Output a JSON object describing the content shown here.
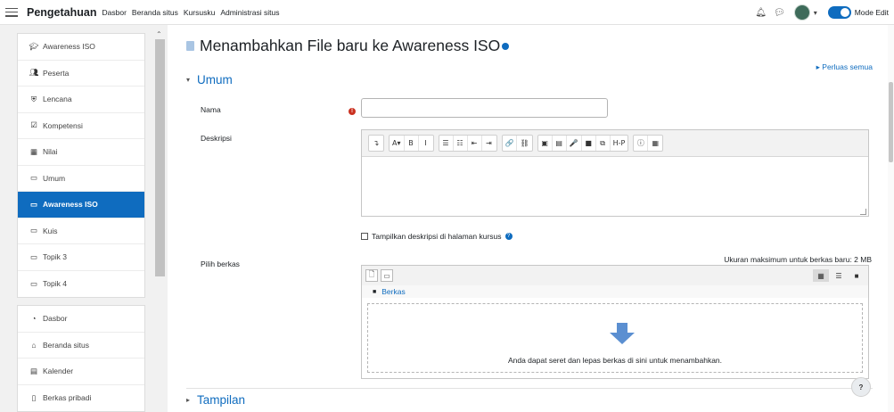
{
  "navbar": {
    "brand": "Pengetahuan",
    "links": [
      "Dasbor",
      "Beranda situs",
      "Kursusku",
      "Administrasi situs"
    ],
    "edit_mode_label": "Mode Edit",
    "edit_mode_on": true
  },
  "drawer": {
    "course_items": [
      {
        "icon": "graduation-cap-icon",
        "glyph": "🎓",
        "label": "Awareness ISO"
      },
      {
        "icon": "users-icon",
        "glyph": "👥",
        "label": "Peserta"
      },
      {
        "icon": "shield-icon",
        "glyph": "⛨",
        "label": "Lencana"
      },
      {
        "icon": "checkbox-icon",
        "glyph": "☑",
        "label": "Kompetensi"
      },
      {
        "icon": "table-icon",
        "glyph": "▦",
        "label": "Nilai"
      },
      {
        "icon": "folder-icon",
        "glyph": "▭",
        "label": "Umum"
      },
      {
        "icon": "folder-icon",
        "glyph": "▭",
        "label": "Awareness ISO"
      },
      {
        "icon": "folder-icon",
        "glyph": "▭",
        "label": "Kuis"
      },
      {
        "icon": "folder-icon",
        "glyph": "▭",
        "label": "Topik 3"
      },
      {
        "icon": "folder-icon",
        "glyph": "▭",
        "label": "Topik 4"
      }
    ],
    "active_index": 6,
    "site_items": [
      {
        "icon": "dashboard-icon",
        "glyph": "◔",
        "label": "Dasbor"
      },
      {
        "icon": "home-icon",
        "glyph": "⌂",
        "label": "Beranda situs"
      },
      {
        "icon": "calendar-icon",
        "glyph": "▤",
        "label": "Kalender"
      },
      {
        "icon": "file-icon",
        "glyph": "▯",
        "label": "Berkas pribadi"
      }
    ]
  },
  "main": {
    "title": "Menambahkan File baru ke Awareness ISO",
    "expand_all": "Perluas semua",
    "section_general": "Umum",
    "label_name": "Nama",
    "name_value": "",
    "label_description": "Deskripsi",
    "show_description": "Tampilkan deskripsi di halaman kursus",
    "label_select_files": "Pilih berkas",
    "max_size": "Ukuran maksimum untuk berkas baru: 2 MB",
    "files_path": "Berkas",
    "drop_text": "Anda dapat seret dan lepas berkas di sini untuk menambahkan.",
    "section_appearance": "Tampilan",
    "help_button": "?"
  },
  "editor_toolbar": [
    [
      "↴"
    ],
    [
      "A▾",
      "B",
      "I"
    ],
    [
      "☰",
      "☷",
      "⇤",
      "⇥"
    ],
    [
      "🔗",
      "⛓"
    ],
    [
      "▣",
      "▤",
      "🎤",
      "■",
      "⧉",
      "H-P"
    ],
    [
      "ⓘ",
      "▦"
    ]
  ],
  "colors": {
    "accent": "#0f6cbf",
    "required": "#ca3120",
    "drop_arrow": "#5b8fd1"
  }
}
